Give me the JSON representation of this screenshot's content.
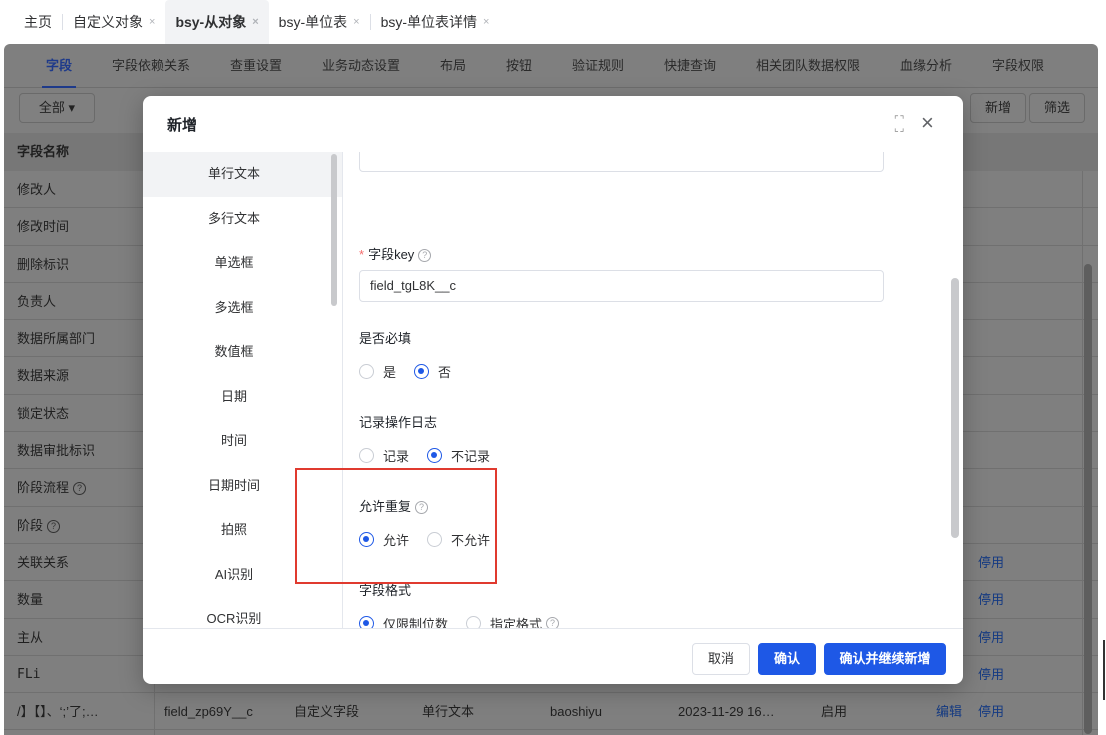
{
  "top_tabs": [
    {
      "label": "主页",
      "closable": false,
      "active": false
    },
    {
      "label": "自定义对象",
      "closable": true,
      "active": false
    },
    {
      "label": "bsy-从对象",
      "closable": true,
      "active": true
    },
    {
      "label": "bsy-单位表",
      "closable": true,
      "active": false
    },
    {
      "label": "bsy-单位表详情",
      "closable": true,
      "active": false
    }
  ],
  "close_glyph": "×",
  "sub_tabs": [
    "字段",
    "字段依赖关系",
    "查重设置",
    "业务动态设置",
    "布局",
    "按钮",
    "验证规则",
    "快捷查询",
    "相关团队数据权限",
    "血缘分析",
    "字段权限"
  ],
  "toolbar": {
    "filter_label": "全部 ▾",
    "add_label": "新增",
    "screen_label": "筛选"
  },
  "table": {
    "header": "字段名称",
    "rows": [
      {
        "name": "修改人"
      },
      {
        "name": "修改时间"
      },
      {
        "name": "删除标识"
      },
      {
        "name": "负责人"
      },
      {
        "name": "数据所属部门"
      },
      {
        "name": "数据来源"
      },
      {
        "name": "锁定状态"
      },
      {
        "name": "数据审批标识"
      },
      {
        "name": "阶段流程",
        "help": "?"
      },
      {
        "name": "阶段",
        "help": "?"
      },
      {
        "name": "关联关系",
        "action": "停用"
      },
      {
        "name": "数量",
        "action": "停用"
      },
      {
        "name": "主从",
        "action": "停用"
      },
      {
        "name": "FLi",
        "action": "停用"
      },
      {
        "name": "/】【】、‘;’了;…",
        "key": "field_zp69Y__c",
        "source": "自定义字段",
        "type": "单行文本",
        "creator": "baoshiyu",
        "time": "2023-11-29 16…",
        "status": "启用",
        "edit": "编辑",
        "action": "停用"
      }
    ]
  },
  "modal": {
    "title": "新增",
    "field_types": [
      "单行文本",
      "多行文本",
      "单选框",
      "多选框",
      "数值框",
      "日期",
      "时间",
      "日期时间",
      "拍照",
      "AI识别",
      "OCR识别"
    ],
    "active_type": "单行文本",
    "field_key_label": "字段key",
    "required_mark": "*",
    "help_glyph": "?",
    "field_key_value": "field_tgL8K__c",
    "required": {
      "label": "是否必填",
      "options": [
        "是",
        "否"
      ],
      "selected": "否"
    },
    "log": {
      "label": "记录操作日志",
      "options": [
        "记录",
        "不记录"
      ],
      "selected": "不记录"
    },
    "duplicate": {
      "label": "允许重复",
      "options": [
        "允许",
        "不允许"
      ],
      "selected": "允许"
    },
    "format": {
      "label": "字段格式",
      "options": [
        "仅限制位数",
        "指定格式"
      ],
      "selected": "仅限制位数"
    },
    "footer": {
      "cancel": "取消",
      "confirm": "确认",
      "confirm_continue": "确认并继续新增"
    }
  },
  "colors": {
    "primary": "#1e58e6",
    "highlight_border": "#e03a2f",
    "link": "#143a82"
  }
}
